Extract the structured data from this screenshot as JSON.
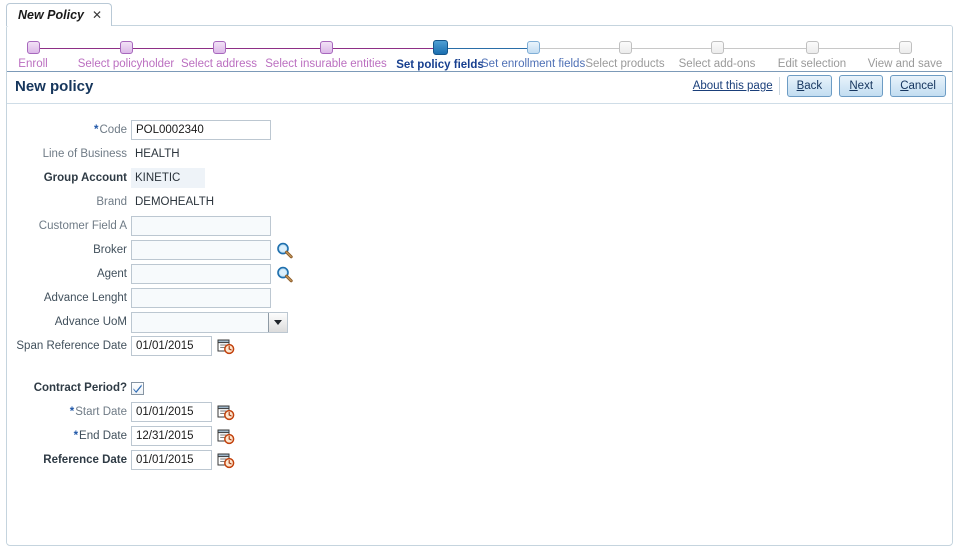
{
  "tab": {
    "label": "New Policy",
    "close_icon": "close-icon"
  },
  "train": {
    "steps": [
      {
        "label": "Enroll",
        "state": "done"
      },
      {
        "label": "Select policyholder",
        "state": "done"
      },
      {
        "label": "Select address",
        "state": "done"
      },
      {
        "label": "Select insurable entities",
        "state": "done"
      },
      {
        "label": "Set policy fields",
        "state": "current"
      },
      {
        "label": "Set enrollment fields",
        "state": "next"
      },
      {
        "label": "Select products",
        "state": "future"
      },
      {
        "label": "Select add-ons",
        "state": "future"
      },
      {
        "label": "Edit selection",
        "state": "future"
      },
      {
        "label": "View and save",
        "state": "future"
      }
    ]
  },
  "header": {
    "title": "New policy",
    "about_link": "About this page",
    "buttons": [
      {
        "label": "Back",
        "accel": "B",
        "rest": "ack"
      },
      {
        "label": "Next",
        "accel": "N",
        "rest": "ext"
      },
      {
        "label": "Cancel",
        "accel": "C",
        "rest": "ancel"
      }
    ]
  },
  "form": {
    "fields": [
      {
        "label": "Code",
        "required": true,
        "type": "input",
        "value": "POL0002340",
        "label_style": "normal"
      },
      {
        "label": "Line of Business",
        "required": false,
        "type": "static",
        "value": "HEALTH",
        "label_style": "normal"
      },
      {
        "label": "Group Account",
        "required": false,
        "type": "static-highlight",
        "value": "KINETIC",
        "label_style": "strong"
      },
      {
        "label": "Brand",
        "required": false,
        "type": "static",
        "value": "DEMOHEALTH",
        "label_style": "normal"
      },
      {
        "label": "Customer Field A",
        "required": false,
        "type": "input",
        "value": "",
        "label_style": "normal"
      },
      {
        "label": "Broker",
        "required": false,
        "type": "input-lov",
        "value": "",
        "label_style": "semi",
        "icon": "search-icon"
      },
      {
        "label": "Agent",
        "required": false,
        "type": "input-lov",
        "value": "",
        "label_style": "semi",
        "icon": "search-icon"
      },
      {
        "label": "Advance Lenght",
        "required": false,
        "type": "input",
        "value": "",
        "label_style": "semi"
      },
      {
        "label": "Advance UoM",
        "required": false,
        "type": "select",
        "value": "",
        "label_style": "semi",
        "icon": "chevron-down-icon"
      },
      {
        "label": "Span Reference Date",
        "required": false,
        "type": "date",
        "value": "01/01/2015",
        "label_style": "semi",
        "icon": "calendar-icon"
      },
      {
        "label": "",
        "required": false,
        "type": "spacer",
        "value": "",
        "label_style": "normal"
      },
      {
        "label": "Contract Period?",
        "required": false,
        "type": "checkbox",
        "value": "checked",
        "label_style": "strong"
      },
      {
        "label": "Start Date",
        "required": true,
        "type": "date",
        "value": "01/01/2015",
        "label_style": "normal",
        "icon": "calendar-icon"
      },
      {
        "label": "End Date",
        "required": true,
        "type": "date",
        "value": "12/31/2015",
        "label_style": "semi",
        "icon": "calendar-icon"
      },
      {
        "label": "Reference Date",
        "required": false,
        "type": "date",
        "value": "01/01/2015",
        "label_style": "strong",
        "icon": "calendar-icon"
      }
    ]
  },
  "colors": {
    "done_step": "#bb6fc0",
    "current_step": "#173f8f",
    "next_step": "#4d6fb5",
    "future_step": "#9a9a9a",
    "title": "#16365c",
    "required_marker": "#2158a8",
    "highlight_bg": "#eef3f8"
  }
}
